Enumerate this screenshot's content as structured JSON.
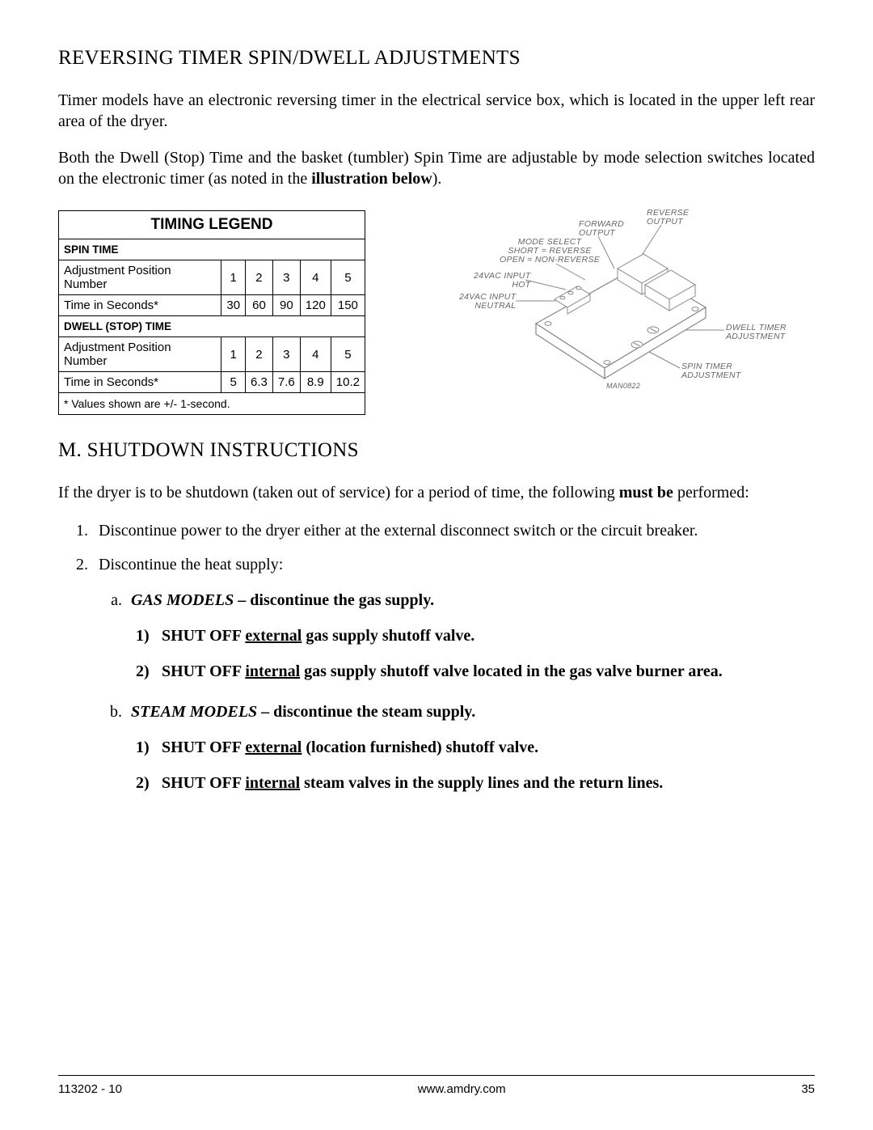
{
  "heading1": "REVERSING TIMER SPIN/DWELL ADJUSTMENTS",
  "p1_a": "Timer models have an electronic reversing timer in the electrical service box, which is located in the upper left rear area of the dryer.",
  "p2_a": "Both the Dwell (Stop) Time and the basket (tumbler) Spin Time are adjustable by mode selection switches located on the electronic timer (as noted in the ",
  "p2_b": "illustration below",
  "p2_c": ").",
  "table": {
    "title": "TIMING LEGEND",
    "spin_hdr": "SPIN TIME",
    "row_pos_label": "Adjustment Position Number",
    "row_time_label": "Time in Seconds*",
    "spin_positions": [
      "1",
      "2",
      "3",
      "4",
      "5"
    ],
    "spin_seconds": [
      "30",
      "60",
      "90",
      "120",
      "150"
    ],
    "dwell_hdr": "DWELL (STOP) TIME",
    "dwell_positions": [
      "1",
      "2",
      "3",
      "4",
      "5"
    ],
    "dwell_seconds": [
      "5",
      "6.3",
      "7.6",
      "8.9",
      "10.2"
    ],
    "footnote": "* Values shown are +/- 1-second."
  },
  "illus": {
    "reverse_output": "REVERSE\nOUTPUT",
    "forward_output": "FORWARD\nOUTPUT",
    "mode_select": "MODE SELECT\nSHORT = REVERSE\nOPEN = NON-REVERSE",
    "vac_hot": "24VAC INPUT\nHOT",
    "vac_neutral": "24VAC INPUT\nNEUTRAL",
    "dwell_adj": "DWELL TIMER\nADJUSTMENT",
    "spin_adj": "SPIN TIMER\nADJUSTMENT",
    "partno": "MAN0822"
  },
  "headingM": "M.  SHUTDOWN INSTRUCTIONS",
  "pM": {
    "a": "If the dryer is to be shutdown (taken out of service) for a period of time, the following ",
    "b": "must be",
    "c": " performed:"
  },
  "step1": "Discontinue power to the dryer either at the external disconnect switch or the circuit breaker.",
  "step2": "Discontinue the heat supply:",
  "gas_label": "GAS MODELS",
  "gas_rest": " – discontinue the gas supply",
  "gas1_a": "SHUT OFF ",
  "gas1_b": "external",
  "gas1_c": " gas supply shutoff valve",
  "gas2_a": "SHUT OFF ",
  "gas2_b": "internal",
  "gas2_c": " gas supply shutoff valve located in the gas valve burner area",
  "steam_label": "STEAM MODELS",
  "steam_rest": " – discontinue the steam supply",
  "steam1_a": "SHUT OFF ",
  "steam1_b": "external",
  "steam1_c": " (location furnished) shutoff valve",
  "steam2_a": "SHUT OFF ",
  "steam2_b": "internal",
  "steam2_c": " steam valves in the supply lines and the return lines",
  "footer": {
    "left": "113202 - 10",
    "center": "www.amdry.com",
    "right": "35"
  }
}
